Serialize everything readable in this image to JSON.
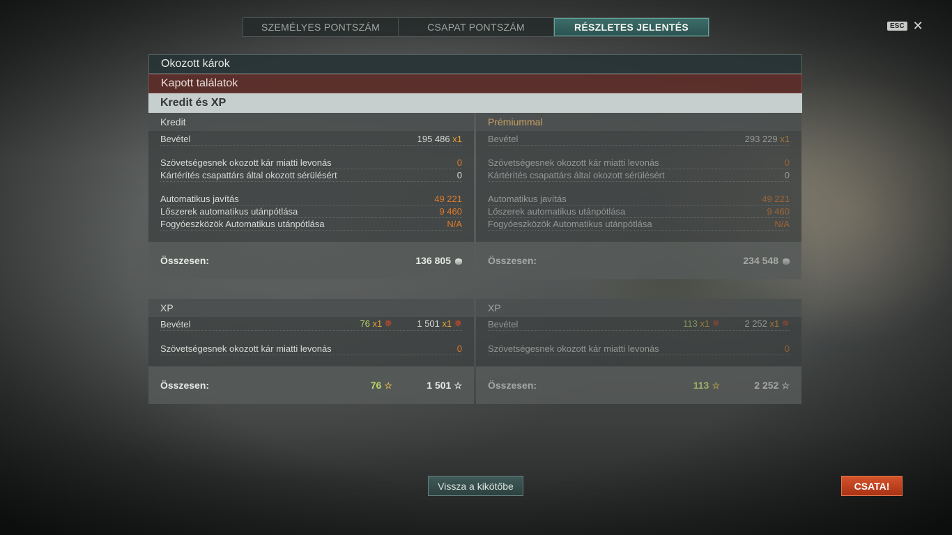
{
  "tabs": {
    "personal": "SZEMÉLYES PONTSZÁM",
    "team": "CSAPAT PONTSZÁM",
    "detailed": "RÉSZLETES JELENTÉS"
  },
  "esc": {
    "key": "ESC",
    "close": "✕"
  },
  "sections": {
    "damage_dealt": "Okozott károk",
    "hits_received": "Kapott találatok",
    "credits_xp": "Kredit és XP"
  },
  "credits": {
    "title": "Kredit",
    "income_label": "Bevétel",
    "income_value": "195 486",
    "income_mult": "x1",
    "ally_damage_label": "Szövetségesnek okozott kár miatti levonás",
    "ally_damage_value": "0",
    "compensation_label": "Kártérítés csapattárs által okozott sérülésért",
    "compensation_value": "0",
    "auto_repair_label": "Automatikus javítás",
    "auto_repair_value": "49 221",
    "auto_ammo_label": "Lőszerek automatikus utánpótlása",
    "auto_ammo_value": "9 460",
    "auto_consumables_label": "Fogyóeszközök Automatikus utánpótlása",
    "auto_consumables_value": "N/A",
    "total_label": "Összesen:",
    "total_value": "136 805"
  },
  "credits_premium": {
    "title": "Prémiummal",
    "income_label": "Bevétel",
    "income_value": "293 229",
    "income_mult": "x1",
    "ally_damage_label": "Szövetségesnek okozott kár miatti levonás",
    "ally_damage_value": "0",
    "compensation_label": "Kártérítés csapattárs által okozott sérülésért",
    "compensation_value": "0",
    "auto_repair_label": "Automatikus javítás",
    "auto_repair_value": "49 221",
    "auto_ammo_label": "Lőszerek automatikus utánpótlása",
    "auto_ammo_value": "9 460",
    "auto_consumables_label": "Fogyóeszközök Automatikus utánpótlása",
    "auto_consumables_value": "N/A",
    "total_label": "Összesen:",
    "total_value": "234 548"
  },
  "xp": {
    "title": "XP",
    "income_label": "Bevétel",
    "income_free": "76",
    "income_free_mult": "x1",
    "income_xp": "1 501",
    "income_xp_mult": "x1",
    "ally_damage_label": "Szövetségesnek okozott kár miatti levonás",
    "ally_damage_value": "0",
    "total_label": "Összesen:",
    "total_free": "76",
    "total_xp": "1 501"
  },
  "xp_premium": {
    "title": "XP",
    "income_label": "Bevétel",
    "income_free": "113",
    "income_free_mult": "x1",
    "income_xp": "2 252",
    "income_xp_mult": "x1",
    "ally_damage_label": "Szövetségesnek okozott kár miatti levonás",
    "ally_damage_value": "0",
    "total_label": "Összesen:",
    "total_free": "113",
    "total_xp": "2 252"
  },
  "buttons": {
    "back_to_port": "Vissza a kikötőbe",
    "battle": "CSATA!"
  }
}
